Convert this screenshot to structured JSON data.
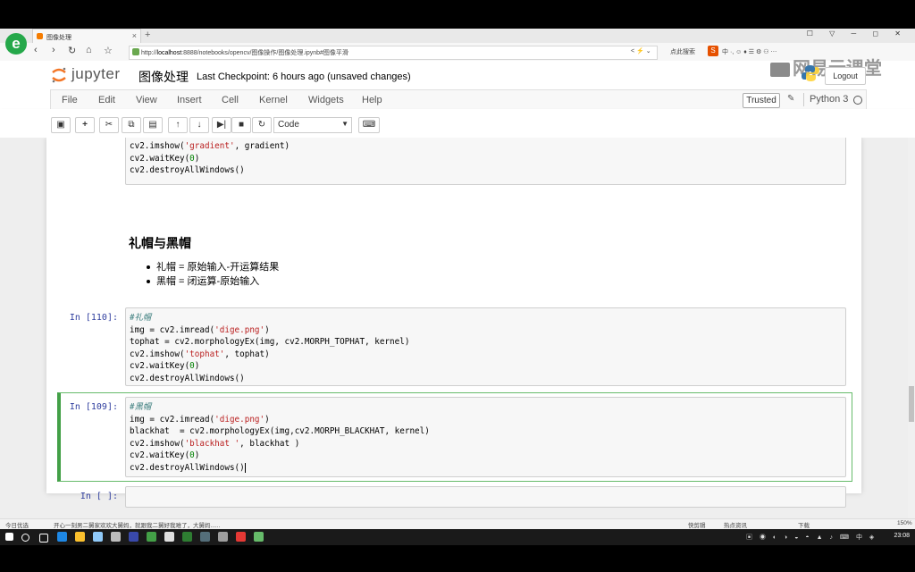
{
  "browser": {
    "tab_title": "图像处理",
    "new_tab_symbol": "+",
    "url_prefix": "http://",
    "url_host": "localhost",
    "url_path": ":8888/notebooks/opencv/图像操作/图像处理.ipynb#图像平滑",
    "search_label": "点此搜索",
    "zoom": "150%"
  },
  "jupyter": {
    "brand": "jupyter",
    "notebook_name": "图像处理",
    "checkpoint": "Last Checkpoint: 6 hours ago (unsaved changes)",
    "logout_label": "Logout",
    "watermark": "网易云课堂"
  },
  "menu": {
    "items": [
      "File",
      "Edit",
      "View",
      "Insert",
      "Cell",
      "Kernel",
      "Widgets",
      "Help"
    ],
    "trusted_label": "Trusted",
    "kernel_label": "Python 3"
  },
  "toolbar": {
    "cell_type": "Code"
  },
  "notebook": {
    "prev_cell_lines": [
      "cv2.imshow('gradient', gradient)",
      "cv2.waitKey(0)",
      "cv2.destroyAllWindows()"
    ],
    "heading": "礼帽与黑帽",
    "bullets": [
      "礼帽 = 原始输入-开运算结果",
      "黑帽 = 闭运算-原始输入"
    ],
    "cell110": {
      "prompt": "In [110]:",
      "lines": [
        "#礼帽",
        "img = cv2.imread('dige.png')",
        "tophat = cv2.morphologyEx(img, cv2.MORPH_TOPHAT, kernel)",
        "cv2.imshow('tophat', tophat)",
        "cv2.waitKey(0)",
        "cv2.destroyAllWindows()"
      ]
    },
    "cell109": {
      "prompt": "In [109]:",
      "lines": [
        "#黑帽",
        "img = cv2.imread('dige.png')",
        "blackhat  = cv2.morphologyEx(img,cv2.MORPH_BLACKHAT, kernel)",
        "cv2.imshow('blackhat ', blackhat )",
        "cv2.waitKey(0)",
        "cv2.destroyAllWindows()"
      ]
    },
    "empty_prompt": "In [ ]:"
  },
  "statusbar": {
    "left": "今日优选",
    "news": "开心一刻男二舅家欢欢大舅妈，就跟我二舅好我难了，大舅妈......",
    "right1": "快剪辑",
    "right2": "热点资讯",
    "right3": "下载"
  },
  "taskbar": {
    "time": "23:08"
  }
}
